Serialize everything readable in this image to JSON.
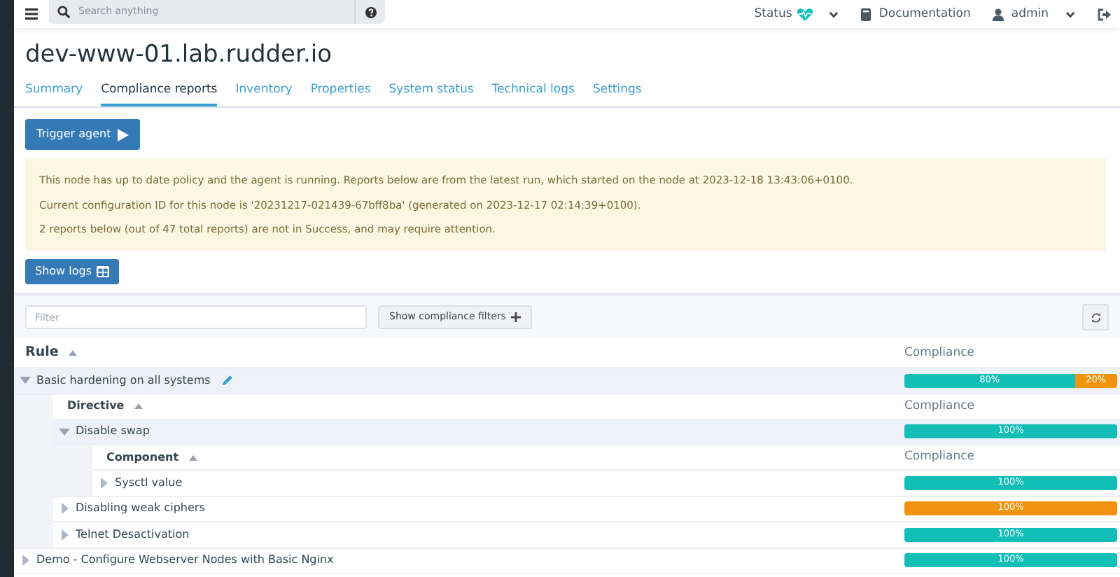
{
  "topbar": {
    "search": {
      "placeholder": "Search anything"
    },
    "status_label": "Status",
    "documentation_link": "Documentation",
    "user_menu": "admin"
  },
  "node_title": "dev-www-01.lab.rudder.io",
  "tabs": [
    {
      "label": "Summary",
      "selected": false
    },
    {
      "label": "Compliance reports",
      "selected": true
    },
    {
      "label": "Inventory",
      "selected": false
    },
    {
      "label": "Properties",
      "selected": false
    },
    {
      "label": "System status",
      "selected": false
    },
    {
      "label": "Technical logs",
      "selected": false
    },
    {
      "label": "Settings",
      "selected": false
    }
  ],
  "trigger_button": "Trigger agent",
  "messages": [
    "This node has up to date policy and the agent is running. Reports below are from the latest run, which started on the node at 2023-12-18 13:43:06+0100.",
    "Current configuration ID for this node is '20231217-021439-67bff8ba' (generated on 2023-12-17 02:14:39+0100).",
    "2 reports below (out of 47 total reports) are not in Success, and may require attention."
  ],
  "show_logs_button": "Show logs",
  "filter": {
    "placeholder": "Filter"
  },
  "compliance_filters_button": "Show compliance filters",
  "table": {
    "columns": [
      "Rule",
      "Compliance"
    ],
    "rows": [
      {
        "name": "Basic hardening on all systems",
        "expanded": true,
        "editable": true,
        "compliance": [
          {
            "label": "80%",
            "level": 0.8,
            "color": "#13beb7"
          },
          {
            "label": "20%",
            "level": 0.2,
            "color": "#f0940f"
          }
        ],
        "sub_columns": [
          "Directive",
          "Compliance"
        ],
        "children": [
          {
            "name": "Disable swap",
            "expanded": true,
            "compliance": [
              {
                "label": "100%",
                "level": 1,
                "color": "#13beb7"
              }
            ],
            "sub_columns": [
              "Component",
              "Compliance"
            ],
            "children": [
              {
                "name": "Sysctl value",
                "expanded": false,
                "compliance": [
                  {
                    "label": "100%",
                    "level": 1,
                    "color": "#13beb7"
                  }
                ]
              }
            ]
          },
          {
            "name": "Disabling weak ciphers",
            "expanded": false,
            "compliance": [
              {
                "label": "100%",
                "level": 1,
                "color": "#f0940f"
              }
            ]
          },
          {
            "name": "Telnet Desactivation",
            "expanded": false,
            "compliance": [
              {
                "label": "100%",
                "level": 1,
                "color": "#13beb7"
              }
            ]
          }
        ]
      },
      {
        "name": "Demo - Configure Webserver Nodes with Basic Nginx",
        "expanded": false,
        "compliance": [
          {
            "label": "100%",
            "level": 1,
            "color": "#13beb7"
          }
        ]
      }
    ]
  }
}
